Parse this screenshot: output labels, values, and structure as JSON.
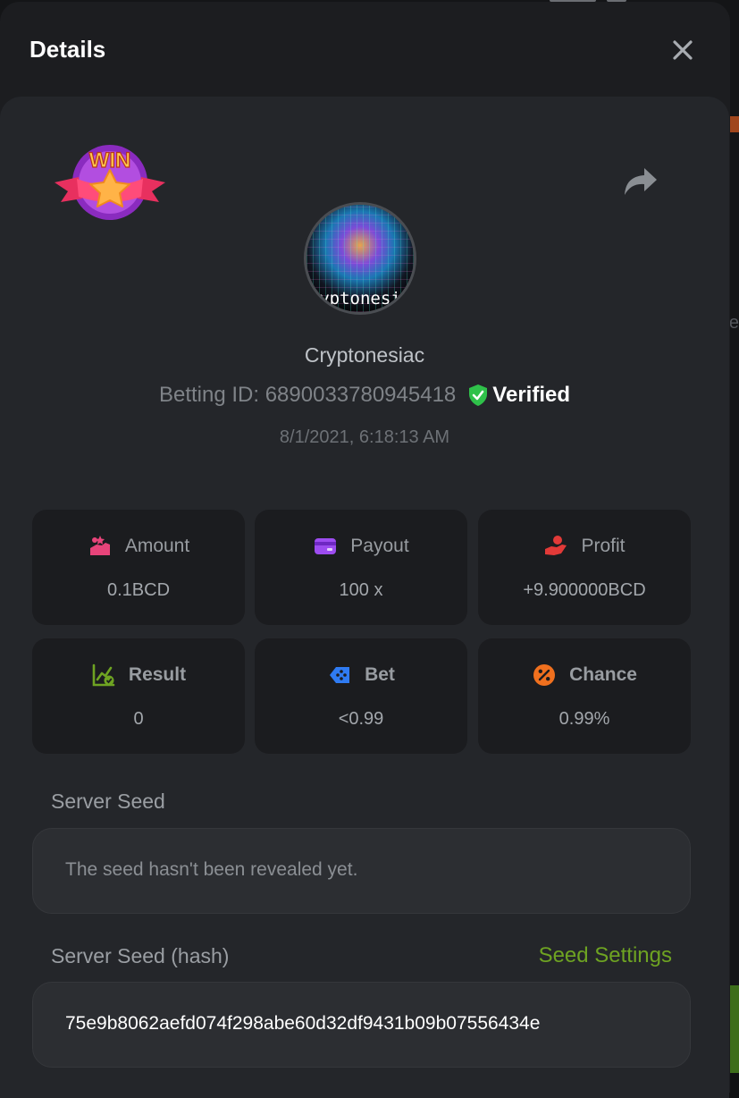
{
  "modal": {
    "title": "Details"
  },
  "bet": {
    "username": "Cryptonesiac",
    "avatar_text": "yptonesi",
    "betting_id": "Betting ID: 6890033780945418",
    "verified_label": "Verified",
    "date": "8/1/2021, 6:18:13 AM",
    "badge_text": "WIN"
  },
  "stats": [
    {
      "label": "Amount",
      "value": "0.1BCD",
      "icon": "coins-hand-icon"
    },
    {
      "label": "Payout",
      "value": "100 x",
      "icon": "card-icon"
    },
    {
      "label": "Profit",
      "value": "+9.900000BCD",
      "icon": "profit-hand-icon"
    },
    {
      "label": "Result",
      "value": "0",
      "icon": "chart-check-icon"
    },
    {
      "label": "Bet",
      "value": "<0.99",
      "icon": "ticket-icon"
    },
    {
      "label": "Chance",
      "value": "0.99%",
      "icon": "percent-icon"
    }
  ],
  "seeds": {
    "server_seed_label": "Server Seed",
    "server_seed_value": "The seed hasn't been revealed yet.",
    "hash_label": "Server Seed (hash)",
    "seed_settings_label": "Seed Settings",
    "hash_value": "75e9b8062aefd074f298abe60d32df9431b09b07556434e"
  },
  "colors": {
    "accent_green": "#6ea322",
    "verified_green": "#2fc14a",
    "amount_icon": "#e8447a",
    "payout_icon": "#9d4cf0",
    "profit_icon": "#e23a38",
    "result_icon": "#6ea322",
    "bet_icon": "#2f7bf2",
    "chance_icon": "#f0701e"
  }
}
